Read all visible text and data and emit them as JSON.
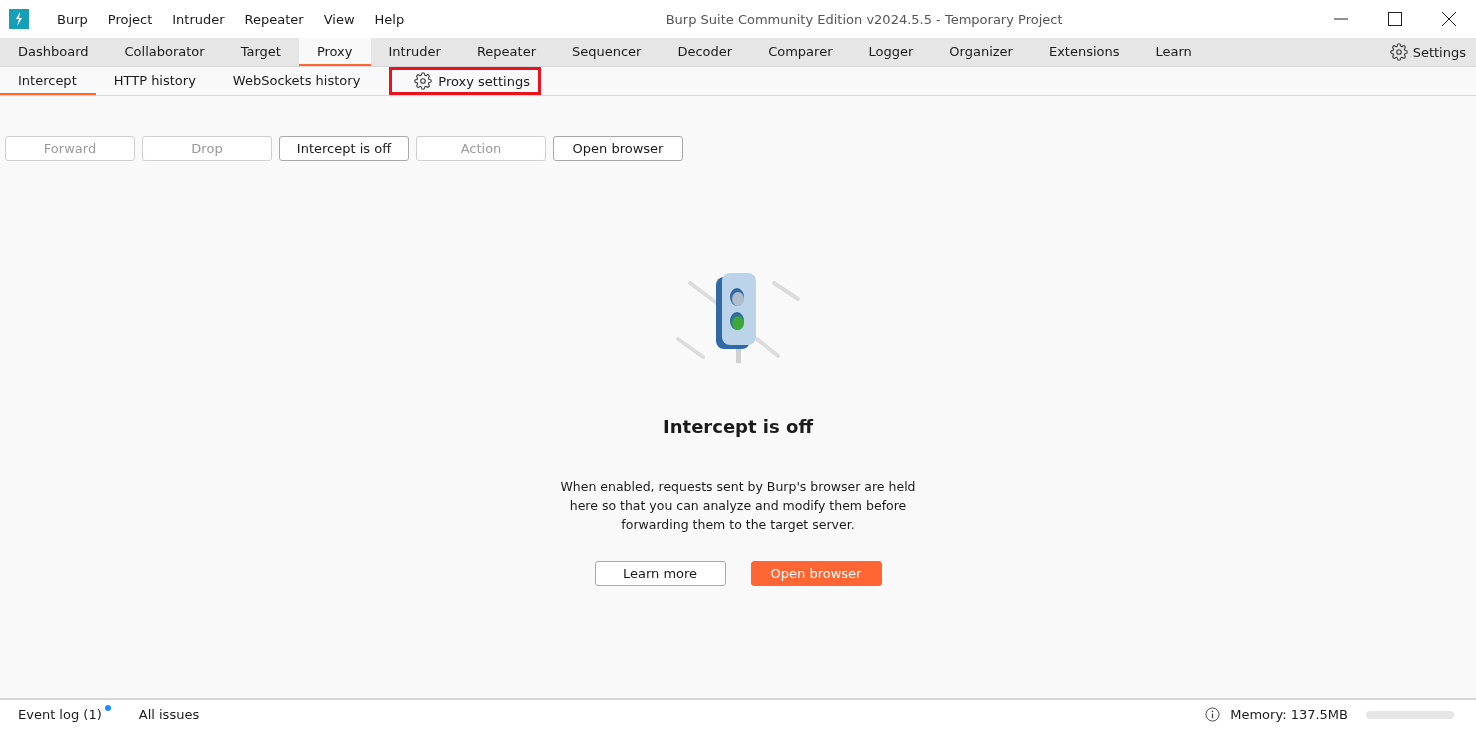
{
  "window": {
    "title": "Burp Suite Community Edition v2024.5.5 - Temporary Project"
  },
  "menu": [
    "Burp",
    "Project",
    "Intruder",
    "Repeater",
    "View",
    "Help"
  ],
  "tabs": [
    {
      "label": "Dashboard",
      "selected": false
    },
    {
      "label": "Collaborator",
      "selected": false
    },
    {
      "label": "Target",
      "selected": false
    },
    {
      "label": "Proxy",
      "selected": true
    },
    {
      "label": "Intruder",
      "selected": false
    },
    {
      "label": "Repeater",
      "selected": false
    },
    {
      "label": "Sequencer",
      "selected": false
    },
    {
      "label": "Decoder",
      "selected": false
    },
    {
      "label": "Comparer",
      "selected": false
    },
    {
      "label": "Logger",
      "selected": false
    },
    {
      "label": "Organizer",
      "selected": false
    },
    {
      "label": "Extensions",
      "selected": false
    },
    {
      "label": "Learn",
      "selected": false
    }
  ],
  "settings_button": "Settings",
  "subtabs": [
    {
      "label": "Intercept",
      "selected": true
    },
    {
      "label": "HTTP history",
      "selected": false
    },
    {
      "label": "WebSockets history",
      "selected": false
    }
  ],
  "proxy_settings": {
    "label": "Proxy settings",
    "highlighted": true
  },
  "toolbar": [
    {
      "label": "Forward",
      "disabled": true
    },
    {
      "label": "Drop",
      "disabled": true
    },
    {
      "label": "Intercept is off",
      "disabled": false
    },
    {
      "label": "Action",
      "disabled": true
    },
    {
      "label": "Open browser",
      "disabled": false
    }
  ],
  "empty_state": {
    "title": "Intercept is off",
    "text": "When enabled, requests sent by Burp's browser are held here so that you can analyze and modify them before forwarding them to the target server.",
    "buttons": [
      {
        "label": "Learn more",
        "kind": "secondary"
      },
      {
        "label": "Open browser",
        "kind": "primary"
      }
    ]
  },
  "status_bar": {
    "event_log": {
      "label": "Event log (1)",
      "unread": true
    },
    "all_issues": "All issues",
    "memory": "Memory: 137.5MB"
  }
}
